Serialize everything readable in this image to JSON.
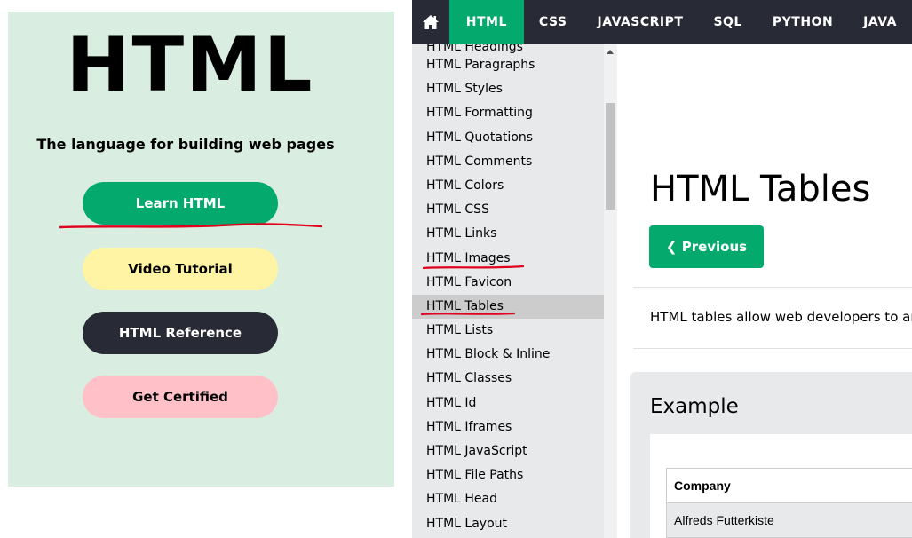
{
  "promo": {
    "title": "HTML",
    "subtitle": "The language for building web pages",
    "buttons": {
      "learn": "Learn HTML",
      "video": "Video Tutorial",
      "reference": "HTML Reference",
      "certified": "Get Certified"
    }
  },
  "topnav": {
    "home_icon": "home-icon",
    "items": [
      "HTML",
      "CSS",
      "JAVASCRIPT",
      "SQL",
      "PYTHON",
      "JAVA"
    ],
    "active": "HTML"
  },
  "sidebar": {
    "partial_top": "HTML Headings",
    "items": [
      "HTML Paragraphs",
      "HTML Styles",
      "HTML Formatting",
      "HTML Quotations",
      "HTML Comments",
      "HTML Colors",
      "HTML CSS",
      "HTML Links",
      "HTML Images",
      "HTML Favicon",
      "HTML Tables",
      "HTML Lists",
      "HTML Block & Inline",
      "HTML Classes",
      "HTML Id",
      "HTML Iframes",
      "HTML JavaScript",
      "HTML File Paths",
      "HTML Head",
      "HTML Layout"
    ],
    "active": "HTML Tables"
  },
  "main": {
    "title": "HTML Tables",
    "prev_label": "❮ Previous",
    "intro": "HTML tables allow web developers to arrange data into rows and columns.",
    "example_heading": "Example",
    "table": {
      "header": "Company",
      "rows": [
        "Alfreds Futterkiste"
      ]
    }
  },
  "colors": {
    "accent": "#04aa6d",
    "nav_bg": "#282a35",
    "annotation": "#e0001b"
  }
}
